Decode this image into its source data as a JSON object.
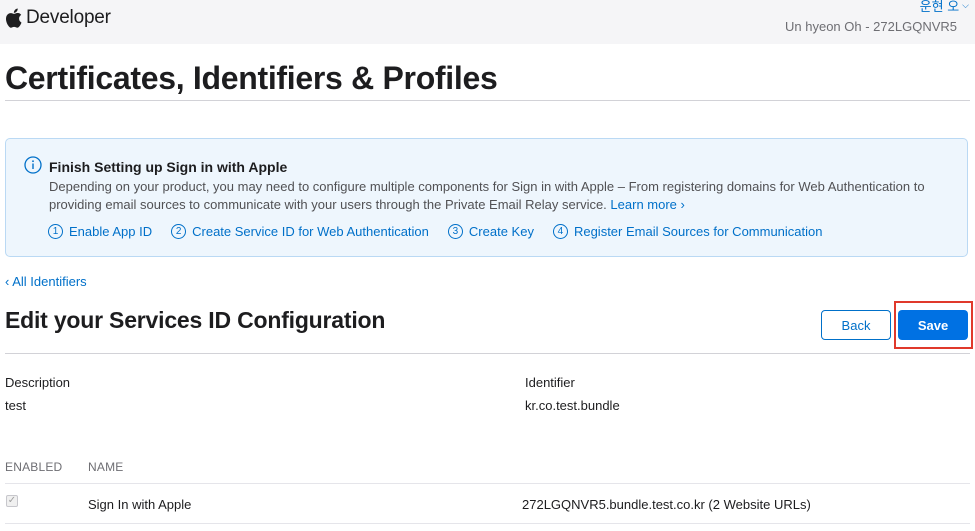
{
  "header": {
    "brand": "Developer",
    "user_name": "운현 오",
    "team": "Un hyeon Oh - 272LGQNVR5"
  },
  "page_title": "Certificates, Identifiers & Profiles",
  "banner": {
    "title": "Finish Setting up Sign in with Apple",
    "body": "Depending on your product, you may need to configure multiple components for Sign in with Apple – From registering domains for Web Authentication to providing email sources to communicate with your users through the Private Email Relay service.",
    "learn_more": "Learn more ›",
    "steps": [
      {
        "num": "1",
        "label": "Enable App ID"
      },
      {
        "num": "2",
        "label": "Create Service ID for Web Authentication"
      },
      {
        "num": "3",
        "label": "Create Key"
      },
      {
        "num": "4",
        "label": "Register Email Sources for Communication"
      }
    ]
  },
  "back_link": "‹ All Identifiers",
  "section": {
    "title": "Edit your Services ID Configuration",
    "back_button": "Back",
    "save_button": "Save"
  },
  "fields": {
    "description_label": "Description",
    "description_value": "test",
    "identifier_label": "Identifier",
    "identifier_value": "kr.co.test.bundle"
  },
  "table": {
    "headers": {
      "enabled": "ENABLED",
      "name": "NAME"
    },
    "rows": [
      {
        "enabled": true,
        "name": "Sign In with Apple",
        "detail": "272LGQNVR5.bundle.test.co.kr (2 Website URLs)"
      }
    ]
  },
  "colors": {
    "accent": "#0070c9",
    "save_button": "#0071e3",
    "highlight": "#e0392b",
    "banner_bg": "#eef6fd"
  }
}
